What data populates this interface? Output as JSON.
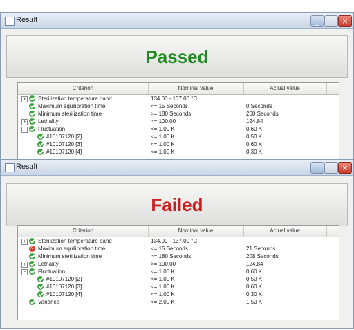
{
  "colors": {
    "passed": "#1f8a1f",
    "failed": "#c81e1e",
    "ok_icon": "#38a23a",
    "error_icon": "#d83a2a"
  },
  "columns": {
    "criterion": "Criterion",
    "nominal": "Nominal value",
    "actual": "Actual value"
  },
  "windows": [
    {
      "title": "Result",
      "status": "Passed",
      "rows": [
        {
          "expander": "+",
          "status": "ok",
          "indent": 0,
          "criterion": "Sterilization temperature band",
          "nominal": "134.00 - 137.00 °C",
          "actual": ""
        },
        {
          "expander": "",
          "status": "ok",
          "indent": 0,
          "criterion": "Maximum equilibration time",
          "nominal": "<= 15 Seconds",
          "actual": "0 Seconds"
        },
        {
          "expander": "",
          "status": "ok",
          "indent": 0,
          "criterion": "Minimum sterilization time",
          "nominal": ">= 180 Seconds",
          "actual": "208 Seconds"
        },
        {
          "expander": "+",
          "status": "ok",
          "indent": 0,
          "criterion": "Lethality",
          "nominal": ">= 100.00",
          "actual": "124.84"
        },
        {
          "expander": "−",
          "status": "ok",
          "indent": 0,
          "criterion": "Fluctuation",
          "nominal": "<= 1.00 K",
          "actual": "0.60 K"
        },
        {
          "expander": "",
          "status": "ok",
          "indent": 1,
          "criterion": "#10107120 [2]",
          "nominal": "<= 1.00 K",
          "actual": "0.50 K"
        },
        {
          "expander": "",
          "status": "ok",
          "indent": 1,
          "criterion": "#10107120 [3]",
          "nominal": "<= 1.00 K",
          "actual": "0.60 K"
        },
        {
          "expander": "",
          "status": "ok",
          "indent": 1,
          "criterion": "#10107120 [4]",
          "nominal": "<= 1.00 K",
          "actual": "0.30 K"
        }
      ]
    },
    {
      "title": "Result",
      "status": "Failed",
      "rows": [
        {
          "expander": "+",
          "status": "ok",
          "indent": 0,
          "criterion": "Sterilization temperature band",
          "nominal": "134.00 - 137.00 °C",
          "actual": ""
        },
        {
          "expander": "",
          "status": "bad",
          "indent": 0,
          "criterion": "Maximum equilibration time",
          "nominal": "<= 15 Seconds",
          "actual": "21 Seconds"
        },
        {
          "expander": "",
          "status": "ok",
          "indent": 0,
          "criterion": "Minimum sterilization time",
          "nominal": ">= 180 Seconds",
          "actual": "208 Seconds"
        },
        {
          "expander": "+",
          "status": "ok",
          "indent": 0,
          "criterion": "Lethality",
          "nominal": ">= 100.00",
          "actual": "124.84"
        },
        {
          "expander": "−",
          "status": "ok",
          "indent": 0,
          "criterion": "Fluctuation",
          "nominal": "<= 1.00 K",
          "actual": "0.60 K"
        },
        {
          "expander": "",
          "status": "ok",
          "indent": 1,
          "criterion": "#10107120 [2]",
          "nominal": "<= 1.00 K",
          "actual": "0.50 K"
        },
        {
          "expander": "",
          "status": "ok",
          "indent": 1,
          "criterion": "#10107120 [3]",
          "nominal": "<= 1.00 K",
          "actual": "0.60 K"
        },
        {
          "expander": "",
          "status": "ok",
          "indent": 1,
          "criterion": "#10107120 [4]",
          "nominal": "<= 1.00 K",
          "actual": "0.30 K"
        },
        {
          "expander": "",
          "status": "ok",
          "indent": 0,
          "criterion": "Variance",
          "nominal": "<= 2.00 K",
          "actual": "1.50 K"
        }
      ]
    }
  ]
}
